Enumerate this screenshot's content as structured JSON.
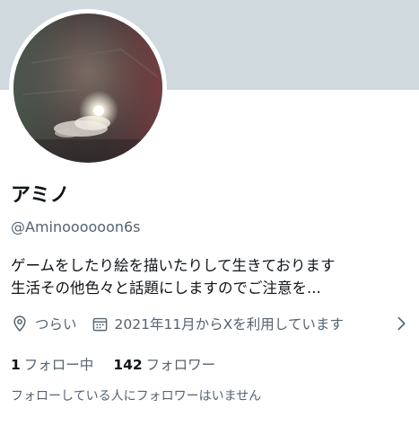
{
  "profile": {
    "display_name": "アミノ",
    "handle": "@Aminoooooon6s",
    "bio_line1": "ゲームをしたり絵を描いたりして生きております",
    "bio_line2": "生活その他色々と話題にしますのでご注意を..."
  },
  "meta": {
    "location": "つらい",
    "location_icon": "map-pin-icon",
    "joined": "2021年11月からXを利用しています",
    "joined_icon": "calendar-icon",
    "expand_icon": "chevron-right-icon"
  },
  "stats": {
    "following_count": "1",
    "following_label": "フォロー中",
    "followers_count": "142",
    "followers_label": "フォロワー"
  },
  "note": "フォローしている人にフォロワーはいません",
  "colors": {
    "banner": "#cfd9de",
    "primary_text": "#0f1419",
    "secondary_text": "#536471"
  }
}
